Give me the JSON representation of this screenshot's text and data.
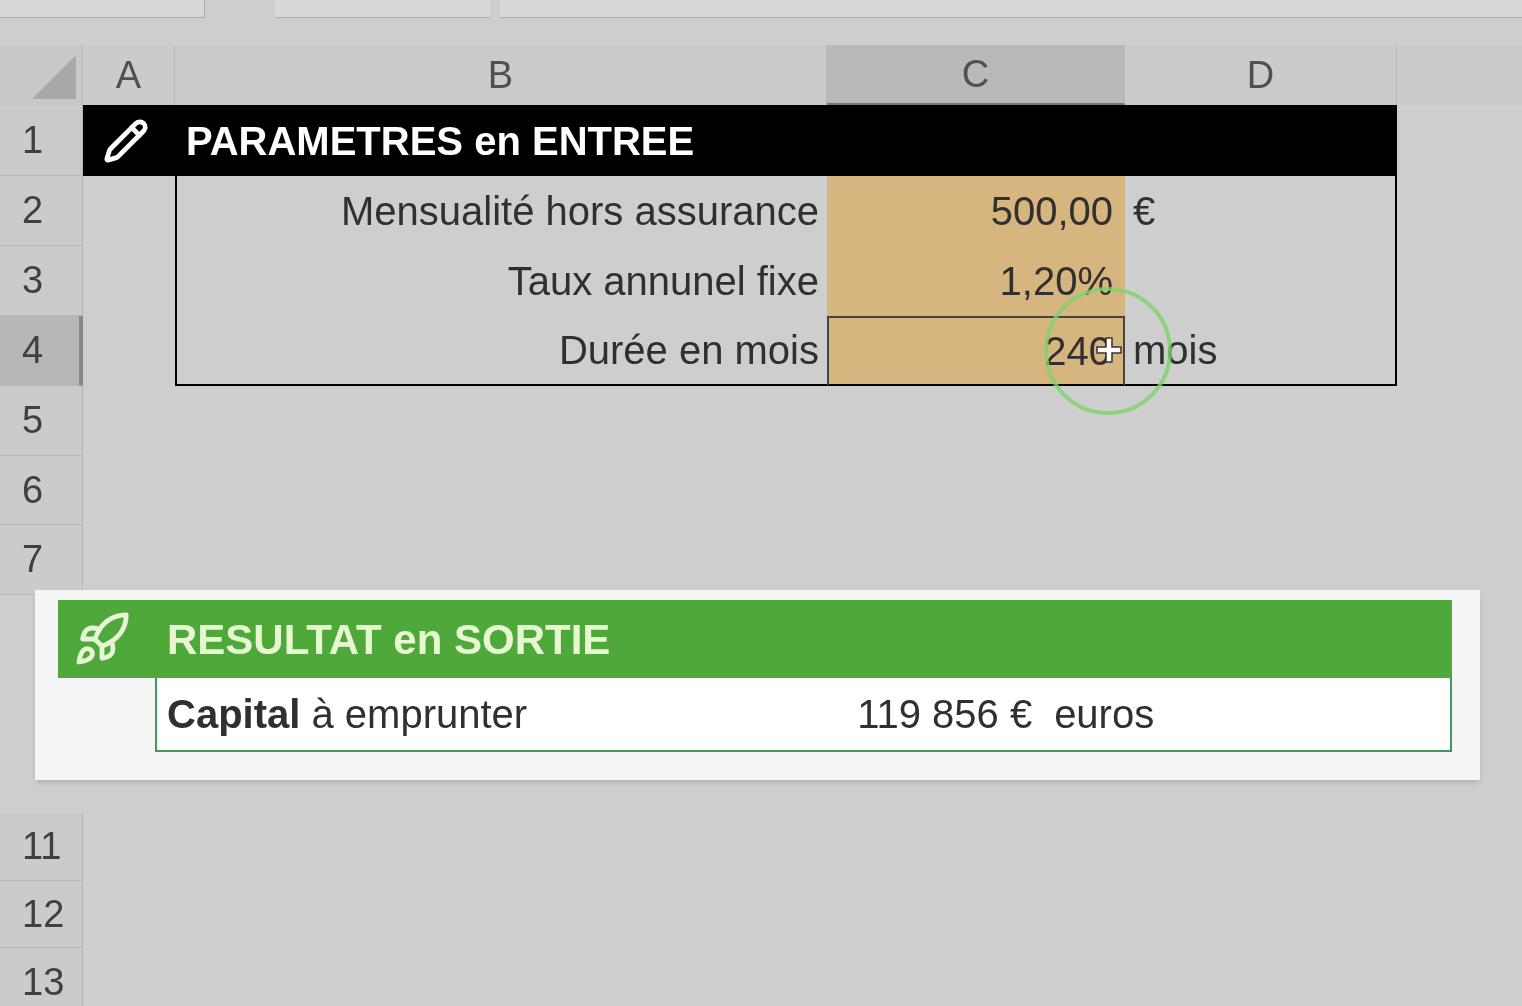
{
  "columns": [
    {
      "label": "A",
      "selected": false
    },
    {
      "label": "B",
      "selected": false
    },
    {
      "label": "C",
      "selected": true
    },
    {
      "label": "D",
      "selected": false
    }
  ],
  "rows": [
    {
      "label": "1",
      "selected": false
    },
    {
      "label": "2",
      "selected": false
    },
    {
      "label": "3",
      "selected": false
    },
    {
      "label": "4",
      "selected": true
    },
    {
      "label": "5",
      "selected": false
    },
    {
      "label": "6",
      "selected": false
    },
    {
      "label": "7",
      "selected": false
    },
    {
      "label": "11",
      "selected": false
    },
    {
      "label": "12",
      "selected": false
    },
    {
      "label": "13",
      "selected": false
    }
  ],
  "input_table": {
    "title": "PARAMETRES en ENTREE",
    "rows": [
      {
        "label": "Mensualité hors assurance",
        "value": "500,00",
        "unit": "€",
        "selected": false
      },
      {
        "label": "Taux annunel fixe",
        "value": "1,20%",
        "selected": false
      },
      {
        "label": "Durée en mois",
        "value": "240",
        "unit": "mois",
        "selected": true
      }
    ]
  },
  "output_table": {
    "title": "RESULTAT en SORTIE",
    "label": "**Capital** à emprunter",
    "value": "119 856 €",
    "unit": "euros"
  }
}
